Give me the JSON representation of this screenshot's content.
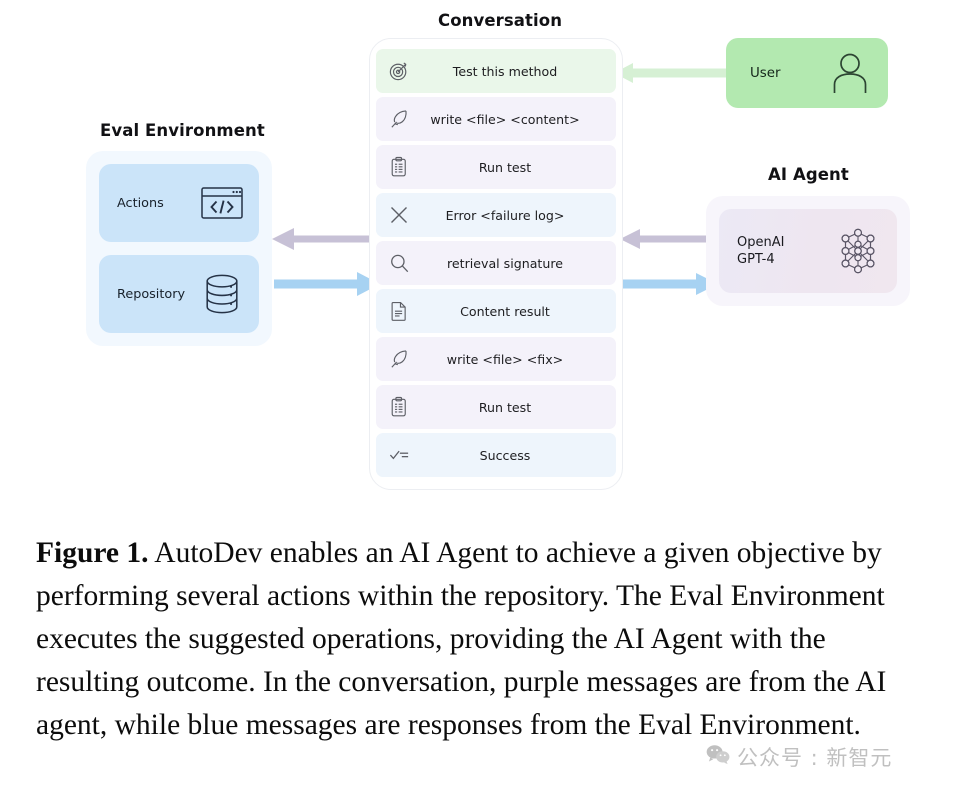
{
  "figure": {
    "panels": {
      "conversation_title": "Conversation",
      "eval_title": "Eval Environment",
      "agent_title": "AI Agent"
    },
    "conversation": {
      "messages": [
        {
          "icon": "target-icon",
          "text": "Test this method",
          "tone": "green"
        },
        {
          "icon": "quill-icon",
          "text": "write <file> <content>",
          "tone": "purple"
        },
        {
          "icon": "clipboard-icon",
          "text": "Run test",
          "tone": "purple"
        },
        {
          "icon": "cross-icon",
          "text": "Error <failure log>",
          "tone": "blue"
        },
        {
          "icon": "magnifier-icon",
          "text": "retrieval signature",
          "tone": "purple"
        },
        {
          "icon": "document-icon",
          "text": "Content result",
          "tone": "blue"
        },
        {
          "icon": "quill-icon",
          "text": "write <file> <fix>",
          "tone": "purple"
        },
        {
          "icon": "clipboard-icon",
          "text": "Run test",
          "tone": "purple"
        },
        {
          "icon": "checklist-icon",
          "text": "Success",
          "tone": "blue"
        }
      ]
    },
    "eval_environment": {
      "cards": [
        {
          "label": "Actions",
          "icon": "code-window-icon"
        },
        {
          "label": "Repository",
          "icon": "database-icon"
        }
      ]
    },
    "user": {
      "label": "User",
      "icon": "person-icon"
    },
    "ai_agent": {
      "label": "OpenAI\nGPT-4",
      "icon": "neural-network-icon"
    },
    "arrows": [
      {
        "name": "user-to-conversation",
        "direction": "left",
        "color": "#d6f0d4"
      },
      {
        "name": "agent-to-conversation",
        "direction": "left",
        "color": "#c7c1d6"
      },
      {
        "name": "conversation-to-agent",
        "direction": "right",
        "color": "#a7d2f2"
      },
      {
        "name": "conversation-to-eval",
        "direction": "left",
        "color": "#c7c1d6"
      },
      {
        "name": "eval-to-conversation",
        "direction": "right",
        "color": "#a7d2f2"
      }
    ],
    "colors": {
      "green_message": "#eaf7ea",
      "purple_message": "#f4f2fa",
      "blue_message": "#eef5fc",
      "eval_card": "#cbe4f9",
      "user_box": "#b3e9b0",
      "agent_card": "#ece9f5"
    }
  },
  "caption": {
    "figure_number": "Figure 1.",
    "text": " AutoDev enables an AI Agent to achieve a given objective by performing several actions within the repository. The Eval Environment executes the suggested operations, providing the AI Agent with the resulting outcome. In the conversation, purple messages are from the AI agent, while blue messages are responses from the Eval Environment."
  },
  "watermark": {
    "text": "公众号 : 新智元",
    "icon": "wechat-icon"
  }
}
